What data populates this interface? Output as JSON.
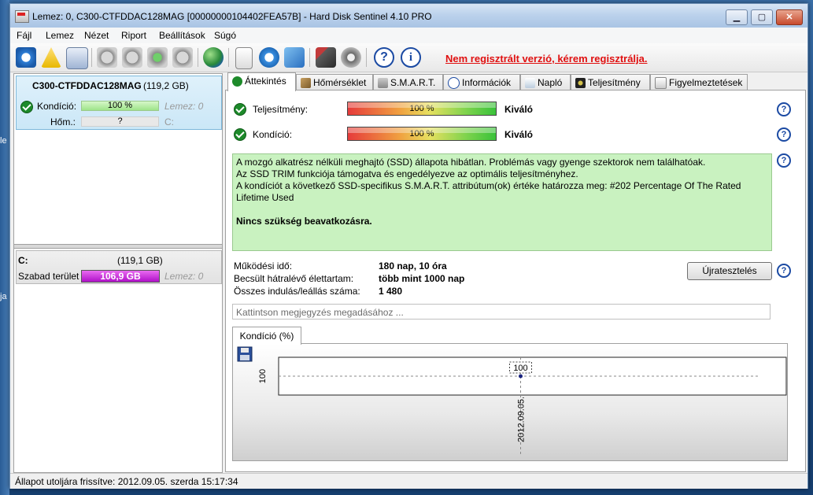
{
  "window": {
    "title": "Lemez: 0, C300-CTFDDAC128MAG [00000000104402FEA57B]  -  Hard Disk Sentinel 4.10 PRO",
    "min_label": "▁",
    "max_label": "▢",
    "close_label": "✕"
  },
  "desktop": {
    "fragments": [
      "le",
      "ja"
    ]
  },
  "menu": {
    "items": [
      "Fájl",
      "Lemez",
      "Nézet",
      "Riport",
      "Beállítások",
      "Súgó"
    ]
  },
  "toolbar": {
    "icons": [
      "refresh-icon",
      "warning-icon",
      "disk-icon",
      "disk-tool-icon",
      "disk-tool-2-icon",
      "disk-ok-icon",
      "disk-tool-3-icon",
      "globe-icon",
      "report-icon",
      "transfer-icon",
      "network-icon",
      "settings-icon",
      "sound-icon",
      "help-icon",
      "info-icon"
    ],
    "unregistered_text": "Nem regisztrált verzió, kérem regisztrálja."
  },
  "left": {
    "disk": {
      "name": "C300-CTFDDAC128MAG",
      "size": "(119,2 GB)",
      "health_label": "Kondíció:",
      "health_value": "100 %",
      "health_percent": 100,
      "disk_label": "Lemez: 0",
      "temp_label": "Hőm.:",
      "temp_value": "?",
      "drive_letter": "C:"
    },
    "partition": {
      "letter": "C:",
      "size": "(119,1 GB)",
      "free_label": "Szabad terület",
      "free_value": "106,9 GB",
      "disk_label": "Lemez: 0"
    }
  },
  "tabs": [
    {
      "label": "Áttekintés",
      "icon": "check-icon",
      "active": true
    },
    {
      "label": "Hőmérséklet",
      "icon": "pen-icon",
      "active": false
    },
    {
      "label": "S.M.A.R.T.",
      "icon": "smart-icon",
      "active": false
    },
    {
      "label": "Információk",
      "icon": "info-icon",
      "active": false
    },
    {
      "label": "Napló",
      "icon": "log-icon",
      "active": false
    },
    {
      "label": "Teljesítmény",
      "icon": "gauge-icon",
      "active": false
    },
    {
      "label": "Figyelmeztetések",
      "icon": "alerts-icon",
      "active": false
    }
  ],
  "overview": {
    "performance_label": "Teljesítmény:",
    "performance_value": "100 %",
    "performance_percent": 100,
    "performance_rating": "Kiváló",
    "health_label": "Kondíció:",
    "health_value": "100 %",
    "health_percent": 100,
    "health_rating": "Kiváló",
    "message_lines": [
      "A mozgó alkatrész nélküli meghajtó (SSD) állapota hibátlan. Problémás vagy gyenge szektorok nem találhatóak.",
      "Az SSD TRIM funkciója támogatva és engedélyezve az optimális teljesítményhez.",
      "A kondíciót a következő SSD-specifikus S.M.A.R.T. attribútum(ok) értéke határozza meg:  #202 Percentage Of The Rated",
      "Lifetime Used"
    ],
    "message_bold": "Nincs szükség beavatkozásra.",
    "uptime_label": "Működési idő:",
    "uptime_value": "180 nap, 10 óra",
    "remaining_label": "Becsült hátralévő élettartam:",
    "remaining_value": "több mint 1000 nap",
    "startstop_label": "Összes indulás/leállás száma:",
    "startstop_value": "1 480",
    "retest_button": "Újratesztelés",
    "note_placeholder": "Kattintson megjegyzés megadásához ...",
    "help_glyph": "?"
  },
  "chart_data": {
    "type": "line",
    "tab_label": "Kondíció  (%)",
    "x": [
      "2012.09.05."
    ],
    "series": [
      {
        "values": [
          100
        ]
      }
    ],
    "ylabel_tick": "100",
    "data_label": "100",
    "grid": true
  },
  "status": {
    "text": "Állapot utoljára frissítve: 2012.09.05. szerda 15:17:34"
  }
}
